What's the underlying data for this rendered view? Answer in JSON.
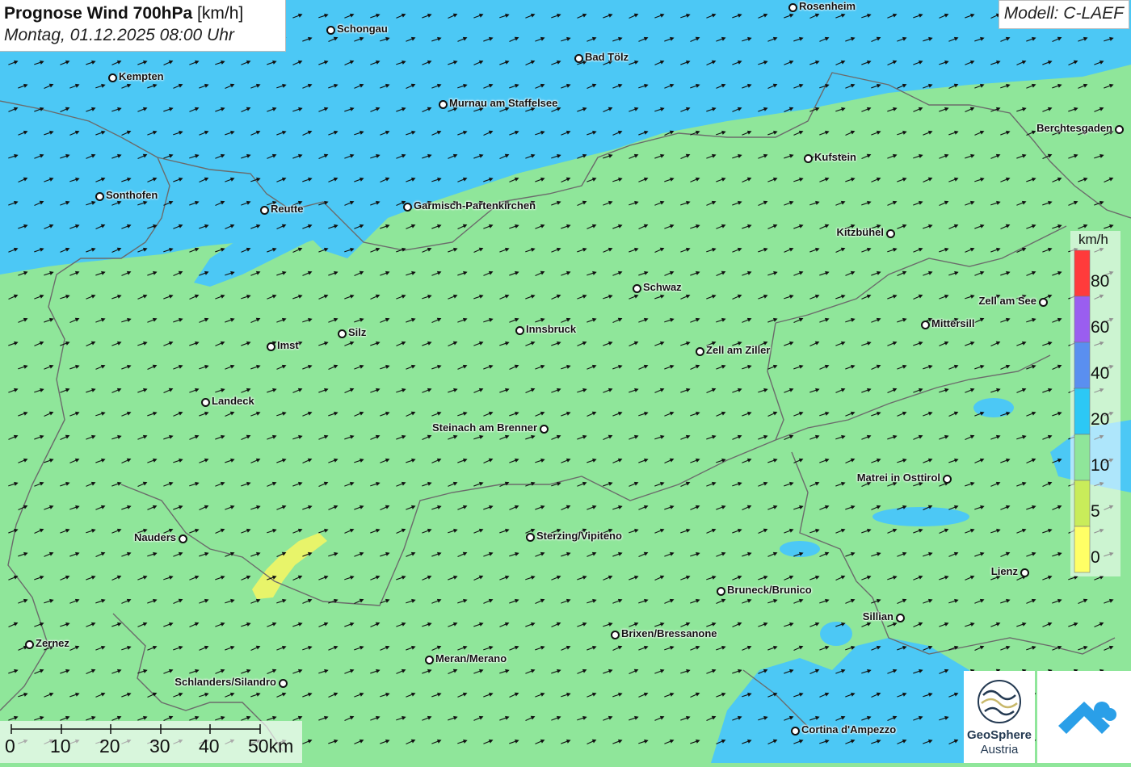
{
  "title": {
    "main_bold": "Prognose Wind 700hPa",
    "main_unit": "[km/h]",
    "datetime": "Montag, 01.12.2025 08:00 Uhr"
  },
  "model": "Modell: C-LAEF",
  "colors": {
    "wind_10_20": "#8fe69a",
    "wind_20_40": "#4cc8f5",
    "wind_5_10": "#d7ef6e",
    "wind_0_5": "#ffff66",
    "arrows": "#111111",
    "borders": "#6b6b6b"
  },
  "legend": {
    "unit": "km/h",
    "labels": [
      "80",
      "60",
      "40",
      "20",
      "10",
      "5",
      "0"
    ],
    "colors": [
      "#ff3b3b",
      "#9a5ef0",
      "#5a8ff0",
      "#2cc8f5",
      "#8fe69a",
      "#c9ec5a",
      "#ffff66"
    ]
  },
  "scale_bar": {
    "labels": [
      "0",
      "10",
      "20",
      "30",
      "40",
      "50km"
    ]
  },
  "cities": [
    {
      "name": "Rosenheim"
    },
    {
      "name": "Schongau"
    },
    {
      "name": "Bad Tölz"
    },
    {
      "name": "Kempten"
    },
    {
      "name": "Murnau am Staffelsee"
    },
    {
      "name": "Berchtesgaden"
    },
    {
      "name": "Kufstein"
    },
    {
      "name": "Sonthofen"
    },
    {
      "name": "Reutte"
    },
    {
      "name": "Garmisch-Partenkirchen"
    },
    {
      "name": "Kitzbühel"
    },
    {
      "name": "Schwaz"
    },
    {
      "name": "Zell am See"
    },
    {
      "name": "Mittersill"
    },
    {
      "name": "Silz"
    },
    {
      "name": "Innsbruck"
    },
    {
      "name": "Imst"
    },
    {
      "name": "Zell am Ziller"
    },
    {
      "name": "Landeck"
    },
    {
      "name": "Steinach am Brenner"
    },
    {
      "name": "Matrei in Osttirol"
    },
    {
      "name": "Nauders"
    },
    {
      "name": "Sterzing/Vipiteno"
    },
    {
      "name": "Lienz"
    },
    {
      "name": "Bruneck/Brunico"
    },
    {
      "name": "Sillian"
    },
    {
      "name": "Brixen/Bressanone"
    },
    {
      "name": "Zernez"
    },
    {
      "name": "Meran/Merano"
    },
    {
      "name": "Schlanders/Silandro"
    },
    {
      "name": "Cortina d'Ampezzo"
    }
  ],
  "logos": {
    "geosphere_line1": "GeoSphere",
    "geosphere_line2": "Austria"
  }
}
